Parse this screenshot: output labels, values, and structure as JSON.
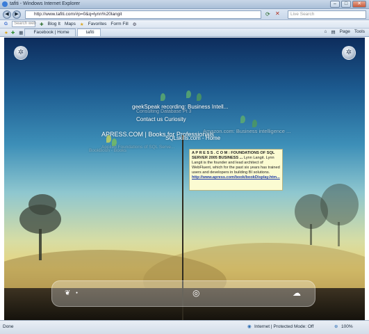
{
  "window": {
    "title": "tafiti - Windows Internet Explorer",
    "min": "–",
    "max": "□",
    "close": "✕"
  },
  "address": {
    "url": "http://www.tafiti.com/#p=0&q=lynn%20langit",
    "search_placeholder": "Live Search"
  },
  "toolbar": {
    "search_placeholder": "Search web",
    "items": [
      "Blog It",
      "Maps",
      "Favorites",
      "Form Fill"
    ]
  },
  "tabs": [
    {
      "label": "Facebook | Home",
      "active": false
    },
    {
      "label": "tafiti",
      "active": true
    }
  ],
  "tabs_right": {
    "page": "Page",
    "tools": "Tools"
  },
  "results": [
    "geekSpeak recording: Business Intell...",
    "Consulting Database Pt 3",
    "Contact us Curiosity",
    "APRESS.COM | Books for Professionals",
    "SQLskills.com - Home",
    "Amazon.com: Business intelligence ...",
    "BookBoon - Books",
    "Applied Foundations of SQL Serve..."
  ],
  "popup": {
    "title": "A P R E S S . C O M : FOUNDATIONS OF SQL SERVER 2005 BUSINESS ...",
    "body": "Lynn Langit. Lynn Langit is the founder and lead architect of WebFluent, which for the past six years has trained users and developers in building BI solutions.",
    "link": "http://www.apress.com/book/bookDisplay.htm..."
  },
  "status": {
    "left": "Done",
    "zone": "Internet | Protected Mode: Off",
    "zoom": "100%"
  },
  "colors": {
    "sky_top": "#0d2c5c",
    "sky_mid": "#3d8fb8",
    "horizon": "#e9d37a",
    "popup_bg": "#fbfbd2",
    "link": "#1a38a8"
  }
}
